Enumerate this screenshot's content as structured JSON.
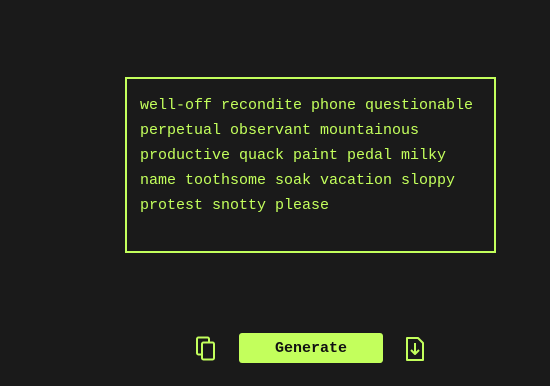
{
  "output": {
    "text": "well-off recondite phone questionable perpetual observant mountainous productive quack paint pedal milky name toothsome soak vacation sloppy protest snotty please"
  },
  "toolbar": {
    "copy_icon": "copy-icon",
    "generate_label": "Generate",
    "download_icon": "download-icon"
  },
  "colors": {
    "background": "#1a1a1a",
    "accent": "#c3ff5c"
  }
}
